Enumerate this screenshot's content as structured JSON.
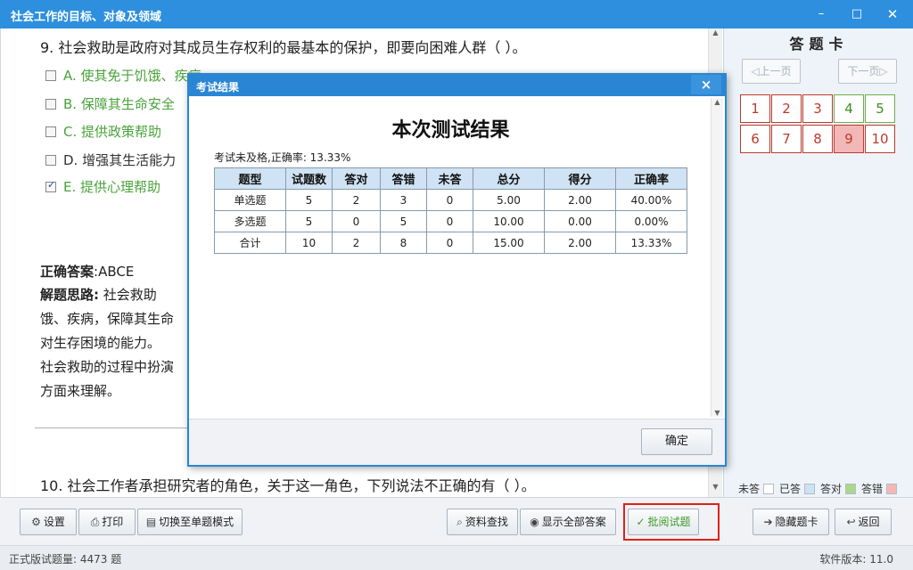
{
  "window": {
    "title": "社会工作的目标、对象及领域",
    "min": "–",
    "max": "□",
    "close": "✕"
  },
  "question": {
    "stem": "9. 社会救助是政府对其成员生存权利的最基本的保护，即要向困难人群（    ）。",
    "options": [
      {
        "text": "A. 使其免于饥饿、疾病",
        "checked": false
      },
      {
        "text": "B. 保障其生命安全",
        "checked": false
      },
      {
        "text": "C. 提供政策帮助",
        "checked": false
      },
      {
        "text": "D. 增强其生活能力",
        "checked": false
      },
      {
        "text": "E. 提供心理帮助",
        "checked": true
      }
    ],
    "answer_label": "正确答案",
    "answer_value": ":ABCE",
    "analysis_label": "解题思路:",
    "analysis_lines": [
      "社会救助",
      "饿、疾病，保障其生命",
      "对生存困境的能力。",
      "社会救助的过程中扮演",
      "方面来理解。"
    ]
  },
  "next_question": {
    "stem": "10. 社会工作者承担研究者的角色，关于这一角色，下列说法不正确的有（    ）。"
  },
  "answer_card": {
    "title": "答题卡",
    "prev": "◁上一页",
    "next": "下一页▷",
    "numbers": [
      "1",
      "2",
      "3",
      "4",
      "5",
      "6",
      "7",
      "8",
      "9",
      "10"
    ],
    "legend": {
      "unanswered": "未答",
      "answered": "已答",
      "correct": "答对",
      "wrong": "答错"
    },
    "colors": {
      "unanswered": "#ffffff",
      "answered": "#c9e3f7",
      "correct": "#a8d88c",
      "wrong": "#f2b8b8"
    }
  },
  "toolbar": {
    "settings": "设置",
    "print": "打印",
    "single_mode": "切换至单题模式",
    "lookup": "资料查找",
    "show_all": "显示全部答案",
    "review": "批阅试题",
    "hide_card": "隐藏题卡",
    "back": "返回"
  },
  "status": {
    "left": "正式版试题量: 4473 题",
    "right": "软件版本: 11.0"
  },
  "dialog": {
    "title": "考试结果",
    "close": "×",
    "heading": "本次测试结果",
    "summary": "考试未及格,正确率: 13.33%",
    "columns": [
      "题型",
      "试题数",
      "答对",
      "答错",
      "未答",
      "总分",
      "得分",
      "正确率"
    ],
    "rows": [
      [
        "单选题",
        "5",
        "2",
        "3",
        "0",
        "5.00",
        "2.00",
        "40.00%"
      ],
      [
        "多选题",
        "5",
        "0",
        "5",
        "0",
        "10.00",
        "0.00",
        "0.00%"
      ],
      [
        "合计",
        "10",
        "2",
        "8",
        "0",
        "15.00",
        "2.00",
        "13.33%"
      ]
    ],
    "ok": "确定"
  }
}
